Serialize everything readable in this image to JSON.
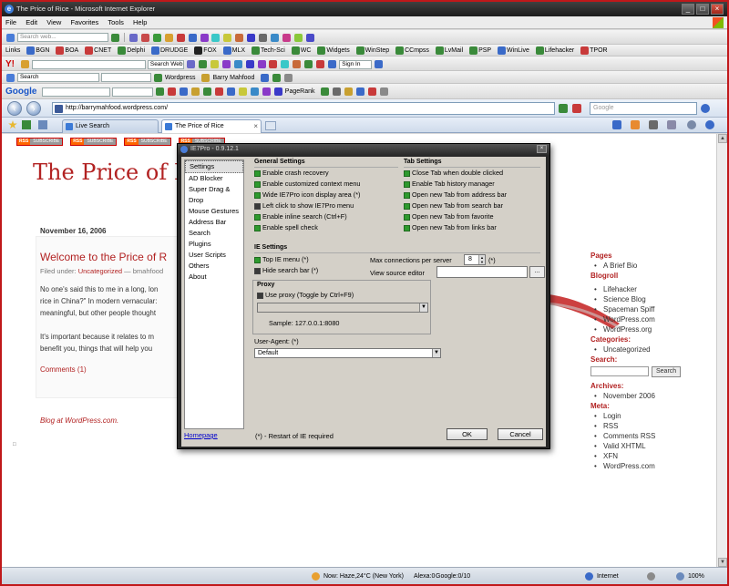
{
  "window": {
    "title": "The Price of Rice - Microsoft Internet Explorer"
  },
  "menubar": [
    "File",
    "Edit",
    "View",
    "Favorites",
    "Tools",
    "Help"
  ],
  "toolbar1": {
    "search_placeholder": "Search web..."
  },
  "links_bar": {
    "label": "Links",
    "items": [
      "BGN",
      "BOA",
      "CNET",
      "Delphi",
      "DRUDGE",
      "FOX",
      "MLX",
      "Tech-Sci",
      "WC",
      "Widgets",
      "WinStep",
      "CCmpss",
      "LvMail",
      "PSP",
      "WinLive",
      "Lifehacker",
      "TPOR"
    ]
  },
  "yahoo_bar": {
    "search_label": "Search Web",
    "sign_in": "Sign In"
  },
  "toolbar4": {
    "search_select": "Search",
    "wordpress": "Wordpress",
    "user": "Barry Mahfood"
  },
  "google_bar": {
    "pagerank": "PageRank"
  },
  "address_bar": {
    "url": "http://barrymahfood.wordpress.com/",
    "search_placeholder": "Google"
  },
  "tabs": [
    {
      "label": "Live Search"
    },
    {
      "label": "The Price of Rice"
    }
  ],
  "page": {
    "rss_buttons": [
      "RSS",
      "SUBSCRIBE"
    ],
    "blog_title": "The Price of Rice",
    "post_date": "November 16, 2006",
    "post_title": "Welcome to the Price of R",
    "filed_under": "Filed under:",
    "category": "Uncategorized",
    "author": "— bmahfood",
    "paragraph1": [
      "No one's said this to me in a long, lon",
      "rice in China?\" In modern vernacular:",
      "meaningful, but other people thought"
    ],
    "paragraph2": [
      "It's important because it relates to m",
      "benefit you, things that will help you"
    ],
    "comments": "Comments (1)",
    "footer": "Blog at WordPress.com."
  },
  "sidebar": {
    "pages_title": "Pages",
    "pages": [
      "A Brief Bio"
    ],
    "blogroll_title": "Blogroll",
    "blogroll": [
      "Lifehacker",
      "Science Blog",
      "Spaceman Spiff",
      "WordPress.com",
      "WordPress.org"
    ],
    "categories_title": "Categories:",
    "categories": [
      "Uncategorized"
    ],
    "search_title": "Search:",
    "search_button": "Search",
    "archives_title": "Archives:",
    "archives": [
      "November 2006"
    ],
    "meta_title": "Meta:",
    "meta": [
      "Login",
      "RSS",
      "Comments RSS",
      "Valid XHTML",
      "XFN",
      "WordPress.com"
    ]
  },
  "dialog": {
    "title": "IE7Pro - 0.9.12.1",
    "nav": [
      "Settings",
      "AD Blocker",
      "Super Drag & Drop",
      "Mouse Gestures",
      "Address Bar",
      "Search",
      "Plugins",
      "User Scripts",
      "Others",
      "About"
    ],
    "homepage": "Homepage",
    "general_title": "General Settings",
    "general": [
      {
        "label": "Enable crash recovery",
        "checked": true
      },
      {
        "label": "Enable customized context menu",
        "checked": true
      },
      {
        "label": "Wide IE7Pro icon display area (*)",
        "checked": true
      },
      {
        "label": "Left click to show IE7Pro menu",
        "checked": false
      },
      {
        "label": "Enable inline search (Ctrl+F)",
        "checked": true
      },
      {
        "label": "Enable spell check",
        "checked": true
      }
    ],
    "tab_title": "Tab Settings",
    "tab": [
      {
        "label": "Close Tab when double clicked",
        "checked": true
      },
      {
        "label": "Enable Tab history manager",
        "checked": true
      },
      {
        "label": "Open new Tab from address bar",
        "checked": true
      },
      {
        "label": "Open new Tab from search bar",
        "checked": true
      },
      {
        "label": "Open new Tab from favorite",
        "checked": true
      },
      {
        "label": "Open new Tab from links bar",
        "checked": true
      }
    ],
    "ie_title": "IE Settings",
    "ie": [
      {
        "label": "Top IE menu (*)",
        "checked": true
      },
      {
        "label": "Hide search bar (*)",
        "checked": false
      }
    ],
    "max_conn_label": "Max connections per server",
    "max_conn_value": "8",
    "max_conn_note": "(*)",
    "view_source_label": "View source editor",
    "browse": "...",
    "proxy_title": "Proxy",
    "proxy_option": {
      "label": "Use proxy (Toggle by Ctrl+F9)",
      "checked": false
    },
    "proxy_sample": "Sample: 127.0.0.1:8080",
    "ua_label": "User-Agent: (*)",
    "ua_value": "Default",
    "restart_note": "(*) - Restart of IE required",
    "ok": "OK",
    "cancel": "Cancel"
  },
  "statusbar": {
    "weather": "Now: Haze,24°C (New York)",
    "alexa": "Alexa:0",
    "google": "Google:0/10",
    "zone": "Internet",
    "zoom": "100%"
  }
}
